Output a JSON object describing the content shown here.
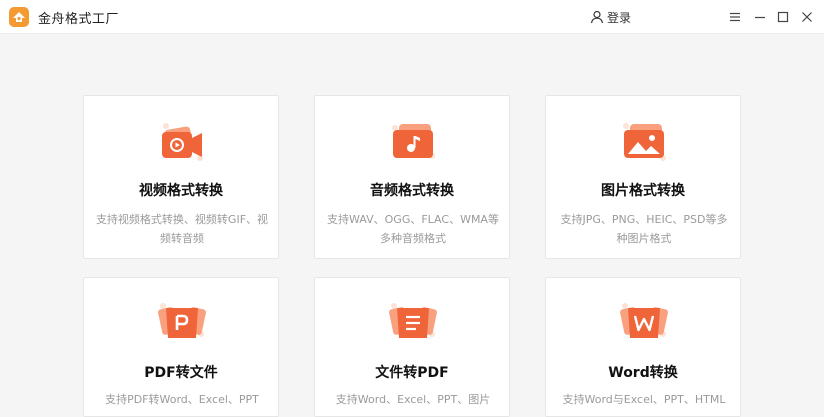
{
  "app": {
    "title": "金舟格式工厂"
  },
  "header": {
    "login_label": "登录"
  },
  "colors": {
    "accent": "#f0643a",
    "accent_light": "#f9a17f"
  },
  "cards": [
    {
      "title": "视频格式转换",
      "desc": "支持视频格式转换、视频转GIF、视频转音频",
      "icon": "video-camera-icon"
    },
    {
      "title": "音频格式转换",
      "desc": "支持WAV、OGG、FLAC、WMA等多种音频格式",
      "icon": "music-note-icon"
    },
    {
      "title": "图片格式转换",
      "desc": "支持JPG、PNG、HEIC、PSD等多种图片格式",
      "icon": "image-icon"
    },
    {
      "title": "PDF转文件",
      "desc": "支持PDF转Word、Excel、PPT",
      "icon": "pdf-icon"
    },
    {
      "title": "文件转PDF",
      "desc": "支持Word、Excel、PPT、图片",
      "icon": "document-icon"
    },
    {
      "title": "Word转换",
      "desc": "支持Word与Excel、PPT、HTML",
      "icon": "word-icon"
    }
  ]
}
